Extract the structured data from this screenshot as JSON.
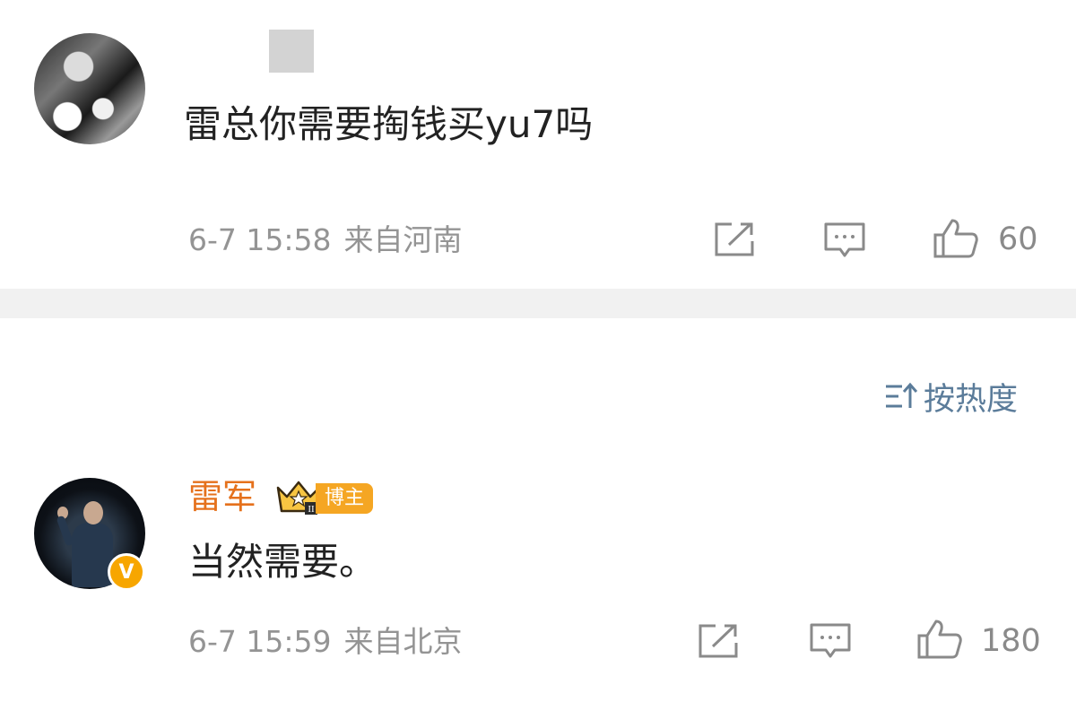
{
  "comments": [
    {
      "avatar_icon": "user-avatar",
      "text": "雷总你需要掏钱买yu7吗",
      "date": "6-7 15:58",
      "location": "来自河南",
      "like_count": "60"
    },
    {
      "avatar_icon": "user-avatar",
      "username": "雷军",
      "badge_label": "博主",
      "crown_level": "II",
      "verified_mark": "V",
      "text": "当然需要。",
      "date": "6-7 15:59",
      "location": "来自北京",
      "like_count": "180"
    }
  ],
  "sort": {
    "label": "按热度",
    "icon": "sort-icon"
  },
  "actions": {
    "share_icon": "share-icon",
    "reply_icon": "comment-icon",
    "like_icon": "thumbs-up-icon"
  },
  "colors": {
    "username": "#e5711c",
    "badge": "#f5a623",
    "sort": "#5b7c9a",
    "meta": "#949494",
    "divider": "#f1f1f1"
  }
}
